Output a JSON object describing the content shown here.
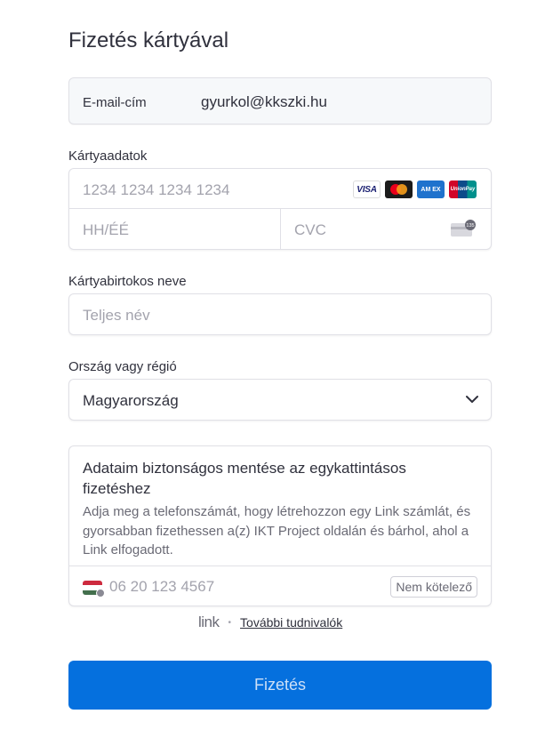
{
  "title": "Fizetés kártyával",
  "email": {
    "label": "E-mail-cím",
    "value": "gyurkol@kkszki.hu"
  },
  "card": {
    "label": "Kártyaadatok",
    "number_placeholder": "1234 1234 1234 1234",
    "expiry_placeholder": "HH/ÉÉ",
    "cvc_placeholder": "CVC",
    "cvc_badge": "135",
    "brands": [
      "visa-icon",
      "mastercard-icon",
      "amex-icon",
      "unionpay-icon"
    ],
    "brand_text": {
      "visa": "VISA",
      "amex": "AM EX",
      "unionpay": "UnionPay"
    }
  },
  "cardholder": {
    "label": "Kártyabirtokos neve",
    "placeholder": "Teljes név"
  },
  "country": {
    "label": "Ország vagy régió",
    "value": "Magyarország"
  },
  "link": {
    "title": "Adataim biztonságos mentése az egykattintásos fizetéshez",
    "description": "Adja meg a telefonszámát, hogy létrehozzon egy Link számlát, és gyorsabban fizethessen a(z) IKT Project oldalán és bárhol, ahol a Link elfogadott.",
    "phone_placeholder": "06 20 123 4567",
    "optional_badge": "Nem kötelező"
  },
  "footer": {
    "logo": "link",
    "separator": "•",
    "more_label": "További tudnivalók"
  },
  "pay_button": "Fizetés",
  "colors": {
    "accent": "#0570de",
    "text": "#30313d",
    "muted": "#6a6a75",
    "placeholder": "#a3a3ad"
  }
}
